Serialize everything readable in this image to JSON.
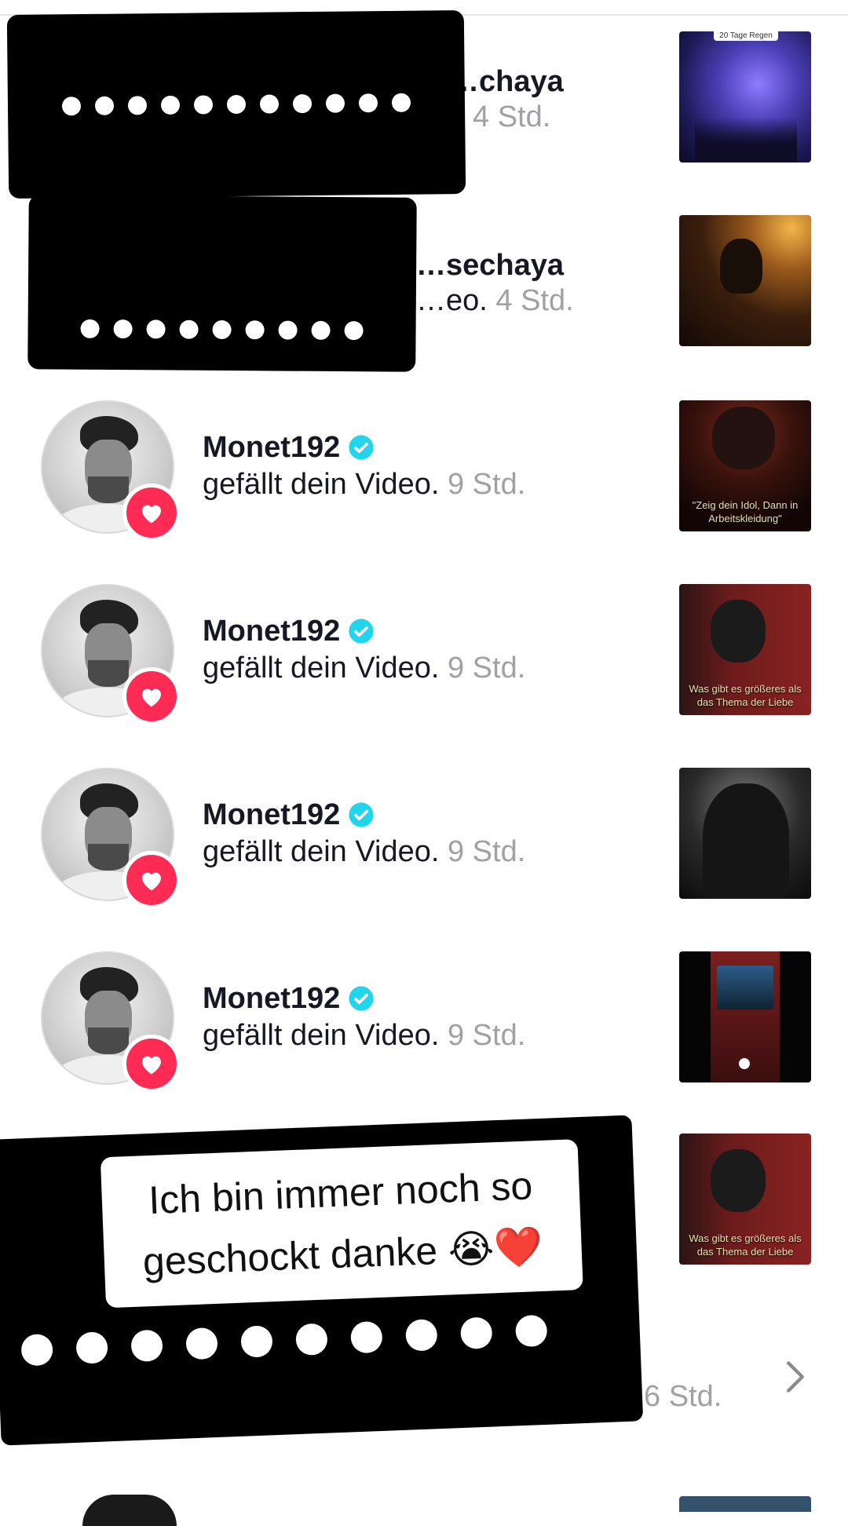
{
  "rows": [
    {
      "username": "…chaya",
      "action": "",
      "time": "4 Std.",
      "thumb_text": "20 Tage Regen"
    },
    {
      "username": "…sechaya",
      "action": "…eo.",
      "time": "4 Std."
    },
    {
      "username": "Monet192",
      "action": "gefällt dein Video.",
      "time": "9 Std.",
      "thumb_text": "\"Zeig dein Idol, Dann in Arbeitskleidung\""
    },
    {
      "username": "Monet192",
      "action": "gefällt dein Video.",
      "time": "9 Std.",
      "thumb_text": "Was gibt es größeres als das Thema der Liebe"
    },
    {
      "username": "Monet192",
      "action": "gefällt dein Video.",
      "time": "9 Std."
    },
    {
      "username": "Monet192",
      "action": "gefällt dein Video.",
      "time": "9 Std."
    },
    {
      "thumb_text": "Was gibt es größeres als das Thema der Liebe"
    },
    {
      "time": "6 Std."
    }
  ],
  "overlay": {
    "caption": "Ich bin immer noch so geschockt danke 😭❤️"
  },
  "colors": {
    "accent": "#fe2c55",
    "verified": "#20d5ec",
    "muted": "#a0a1a7"
  },
  "icons": {
    "like_badge": "heart-icon",
    "verified": "verified-check-icon",
    "more": "chevron-right-icon"
  }
}
